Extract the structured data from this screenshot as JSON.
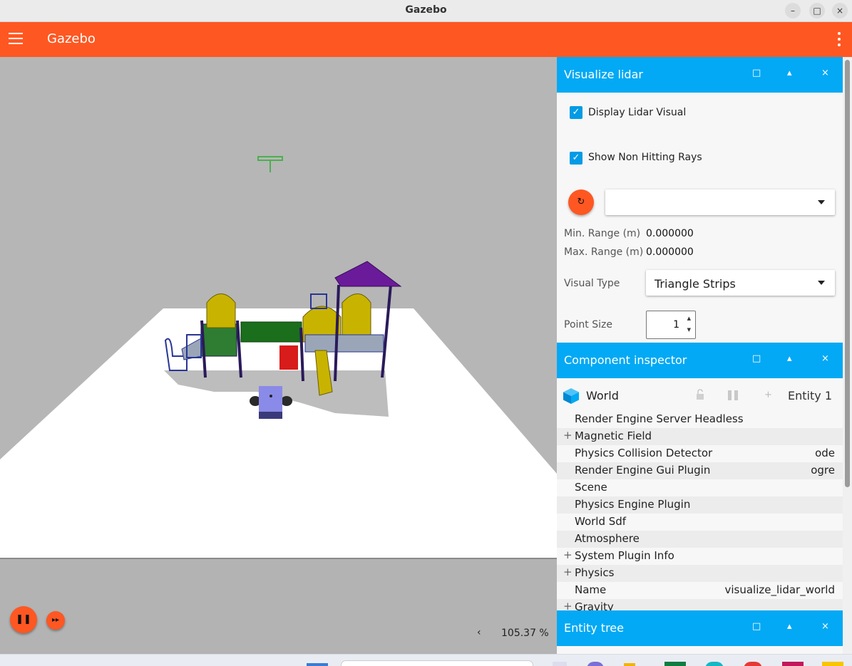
{
  "window": {
    "title": "Gazebo",
    "minimize": "–",
    "maximize": "□",
    "close": "×"
  },
  "appbar": {
    "title": "Gazebo"
  },
  "viewport": {
    "zoom": "105.37 %",
    "prev_glyph": "‹",
    "pause_glyph": "❚❚",
    "step_glyph": "▸▸"
  },
  "lidar_panel": {
    "title": "Visualize lidar",
    "header_buttons": {
      "undock": "□",
      "collapse": "▴",
      "close": "×"
    },
    "display_lidar_visual": {
      "label": "Display Lidar Visual",
      "checked": true
    },
    "show_non_hitting_rays": {
      "label": "Show Non Hitting Rays",
      "checked": true
    },
    "refresh_glyph": "↻",
    "topic": "",
    "min_range_label": "Min. Range (m)",
    "min_range": "0.000000",
    "max_range_label": "Max. Range (m)",
    "max_range": "0.000000",
    "visual_type_label": "Visual Type",
    "visual_type": "Triangle Strips",
    "point_size_label": "Point Size",
    "point_size": "1"
  },
  "inspector": {
    "title": "Component inspector",
    "header_buttons": {
      "undock": "□",
      "collapse": "▴",
      "close": "×"
    },
    "entity_name": "World",
    "add_glyph": "+",
    "entity_id": "Entity 1",
    "rows": [
      {
        "key": "Render Engine Server Headless",
        "value": "",
        "expandable": false
      },
      {
        "key": "Magnetic Field",
        "value": "",
        "expandable": true
      },
      {
        "key": "Physics Collision Detector",
        "value": "ode",
        "expandable": false
      },
      {
        "key": "Render Engine Gui Plugin",
        "value": "ogre",
        "expandable": false
      },
      {
        "key": "Scene",
        "value": "",
        "expandable": false
      },
      {
        "key": "Physics Engine Plugin",
        "value": "",
        "expandable": false
      },
      {
        "key": "World Sdf",
        "value": "",
        "expandable": false
      },
      {
        "key": "Atmosphere",
        "value": "",
        "expandable": false
      },
      {
        "key": "System Plugin Info",
        "value": "",
        "expandable": true
      },
      {
        "key": "Physics",
        "value": "",
        "expandable": true
      },
      {
        "key": "Name",
        "value": "visualize_lidar_world",
        "expandable": false
      },
      {
        "key": "Gravity",
        "value": "",
        "expandable": true
      }
    ],
    "expand_glyph": "+"
  },
  "entity_tree": {
    "title": "Entity tree",
    "header_buttons": {
      "undock": "□",
      "collapse": "▴",
      "close": "×"
    }
  },
  "colors": {
    "accent": "#ff5722",
    "panel_header": "#03a9f4",
    "checkbox": "#039be5",
    "scene_background": "#b6b6b6",
    "ground": "#ffffff"
  }
}
